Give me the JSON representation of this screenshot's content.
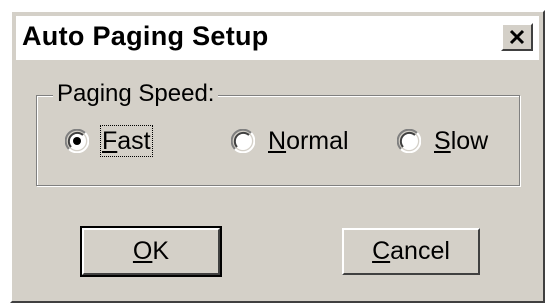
{
  "dialog": {
    "title": "Auto Paging Setup",
    "close_icon": "close-icon"
  },
  "paging_speed": {
    "label": "Paging Speed:",
    "selected": "Fast",
    "options": [
      {
        "access_key": "F",
        "rest": "ast",
        "selected": true
      },
      {
        "access_key": "N",
        "rest": "ormal",
        "selected": false
      },
      {
        "access_key": "S",
        "rest": "low",
        "selected": false
      }
    ]
  },
  "buttons": {
    "ok": {
      "access_key": "O",
      "rest": "K"
    },
    "cancel": {
      "access_key": "C",
      "rest": "ancel"
    }
  },
  "colors": {
    "face": "#d4d0c8",
    "titlebar": "#ffffff",
    "shadow": "#808080",
    "dark_shadow": "#404040"
  }
}
